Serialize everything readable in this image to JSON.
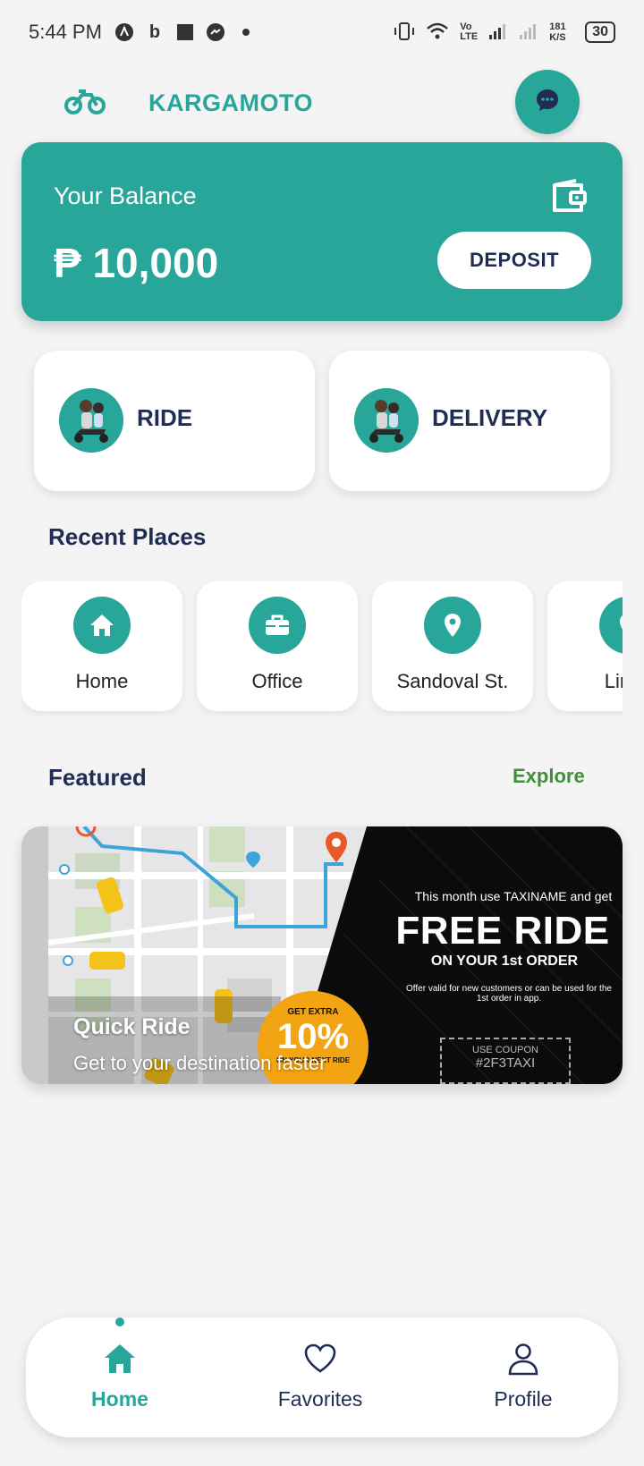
{
  "status_bar": {
    "time": "5:44 PM",
    "network_speed": "181 K/S",
    "battery": "30",
    "icons": [
      "app-a-icon",
      "b-icon",
      "square-icon",
      "messenger-icon",
      "dot-icon",
      "vibrate-icon",
      "wifi-icon",
      "volte-icon",
      "signal-icon",
      "signal-2-icon",
      "battery-icon"
    ]
  },
  "header": {
    "title": "KARGAMOTO",
    "logo_icon": "motorcycle-icon",
    "chat_icon": "chat-bubble-icon"
  },
  "balance": {
    "label": "Your Balance",
    "amount": "₱ 10,000",
    "wallet_icon": "wallet-icon",
    "deposit_label": "DEPOSIT"
  },
  "services": [
    {
      "label": "RIDE"
    },
    {
      "label": "DELIVERY"
    }
  ],
  "recent_places": {
    "title": "Recent Places",
    "items": [
      {
        "label": "Home",
        "icon": "home-icon"
      },
      {
        "label": "Office",
        "icon": "briefcase-icon"
      },
      {
        "label": "Sandoval St.",
        "icon": "location-pin-icon"
      },
      {
        "label": "Linco",
        "icon": "location-pin-icon"
      }
    ]
  },
  "featured": {
    "title": "Featured",
    "explore_label": "Explore",
    "banner": {
      "title": "Quick Ride",
      "subtitle": "Get to your destination faster",
      "promo_small": "This month use TAXINAME and get",
      "promo_big": "FREE RIDE",
      "promo_sub": "ON YOUR 1st ORDER",
      "promo_note": "Offer valid for new customers or can be used for the 1st order in app.",
      "discount_top": "GET EXTRA",
      "discount_value": "10%",
      "discount_bottom": "ON YOUR NEXT RIDE",
      "coupon_label": "USE COUPON",
      "coupon_code": "#2F3TAXI"
    }
  },
  "bottom_nav": {
    "items": [
      {
        "label": "Home",
        "icon": "home-icon",
        "active": true
      },
      {
        "label": "Favorites",
        "icon": "heart-icon",
        "active": false
      },
      {
        "label": "Profile",
        "icon": "person-icon",
        "active": false
      }
    ]
  },
  "colors": {
    "primary": "#28a69a",
    "text_dark": "#1f2d54",
    "explore": "#3f8f3a",
    "background": "#f4f4f5"
  }
}
